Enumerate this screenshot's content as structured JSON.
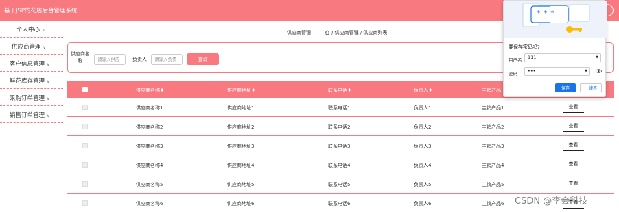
{
  "app": {
    "title": "基于JSP的花店后台管理系统"
  },
  "sidebar": {
    "items": [
      {
        "label": "个人中心"
      },
      {
        "label": "供应商管理"
      },
      {
        "label": "客户信息管理"
      },
      {
        "label": "鲜花库存管理"
      },
      {
        "label": "采购订单管理"
      },
      {
        "label": "销售订单管理"
      }
    ]
  },
  "breadcrumb": {
    "page_title": "供应商管理",
    "path": "/ 供应商管理 / 供应商列表"
  },
  "search": {
    "supplier_label": "供应商名称",
    "supplier_placeholder": "请输入供应",
    "contact_label": "负责人",
    "contact_placeholder": "请输入负责",
    "button_label": "查询"
  },
  "table": {
    "columns": [
      "供应商名称♦",
      "供应商地址♦",
      "联系电话♦",
      "负责人♦",
      "主销产品"
    ],
    "rows": [
      {
        "name": "供应商名称1",
        "address": "供应商地址1",
        "phone": "联系电话1",
        "contact": "负责人1",
        "product": "主销产品1",
        "action": "查看"
      },
      {
        "name": "供应商名称2",
        "address": "供应商地址2",
        "phone": "联系电话2",
        "contact": "负责人2",
        "product": "主销产品2",
        "action": "查看"
      },
      {
        "name": "供应商名称3",
        "address": "供应商地址3",
        "phone": "联系电话3",
        "contact": "负责人3",
        "product": "主销产品3",
        "action": "查看"
      },
      {
        "name": "供应商名称4",
        "address": "供应商地址4",
        "phone": "联系电话4",
        "contact": "负责人4",
        "product": "主销产品4",
        "action": "查看"
      },
      {
        "name": "供应商名称5",
        "address": "供应商地址5",
        "phone": "联系电话5",
        "contact": "负责人5",
        "product": "主销产品5",
        "action": "查看"
      },
      {
        "name": "供应商名称6",
        "address": "供应商地址6",
        "phone": "联系电话6",
        "contact": "负责人6",
        "product": "主销产品6",
        "action": "查看"
      }
    ]
  },
  "password_popup": {
    "title": "要保存密码吗?",
    "username_label": "用户名",
    "username_value": "111",
    "password_label": "密码",
    "password_value": "•••",
    "save_label": "保存",
    "never_label": "一律不",
    "illustration_text": "* * *"
  },
  "watermark": "CSDN @李会科技",
  "colors": {
    "accent": "#f87a80",
    "primary_blue": "#1a73e8"
  }
}
